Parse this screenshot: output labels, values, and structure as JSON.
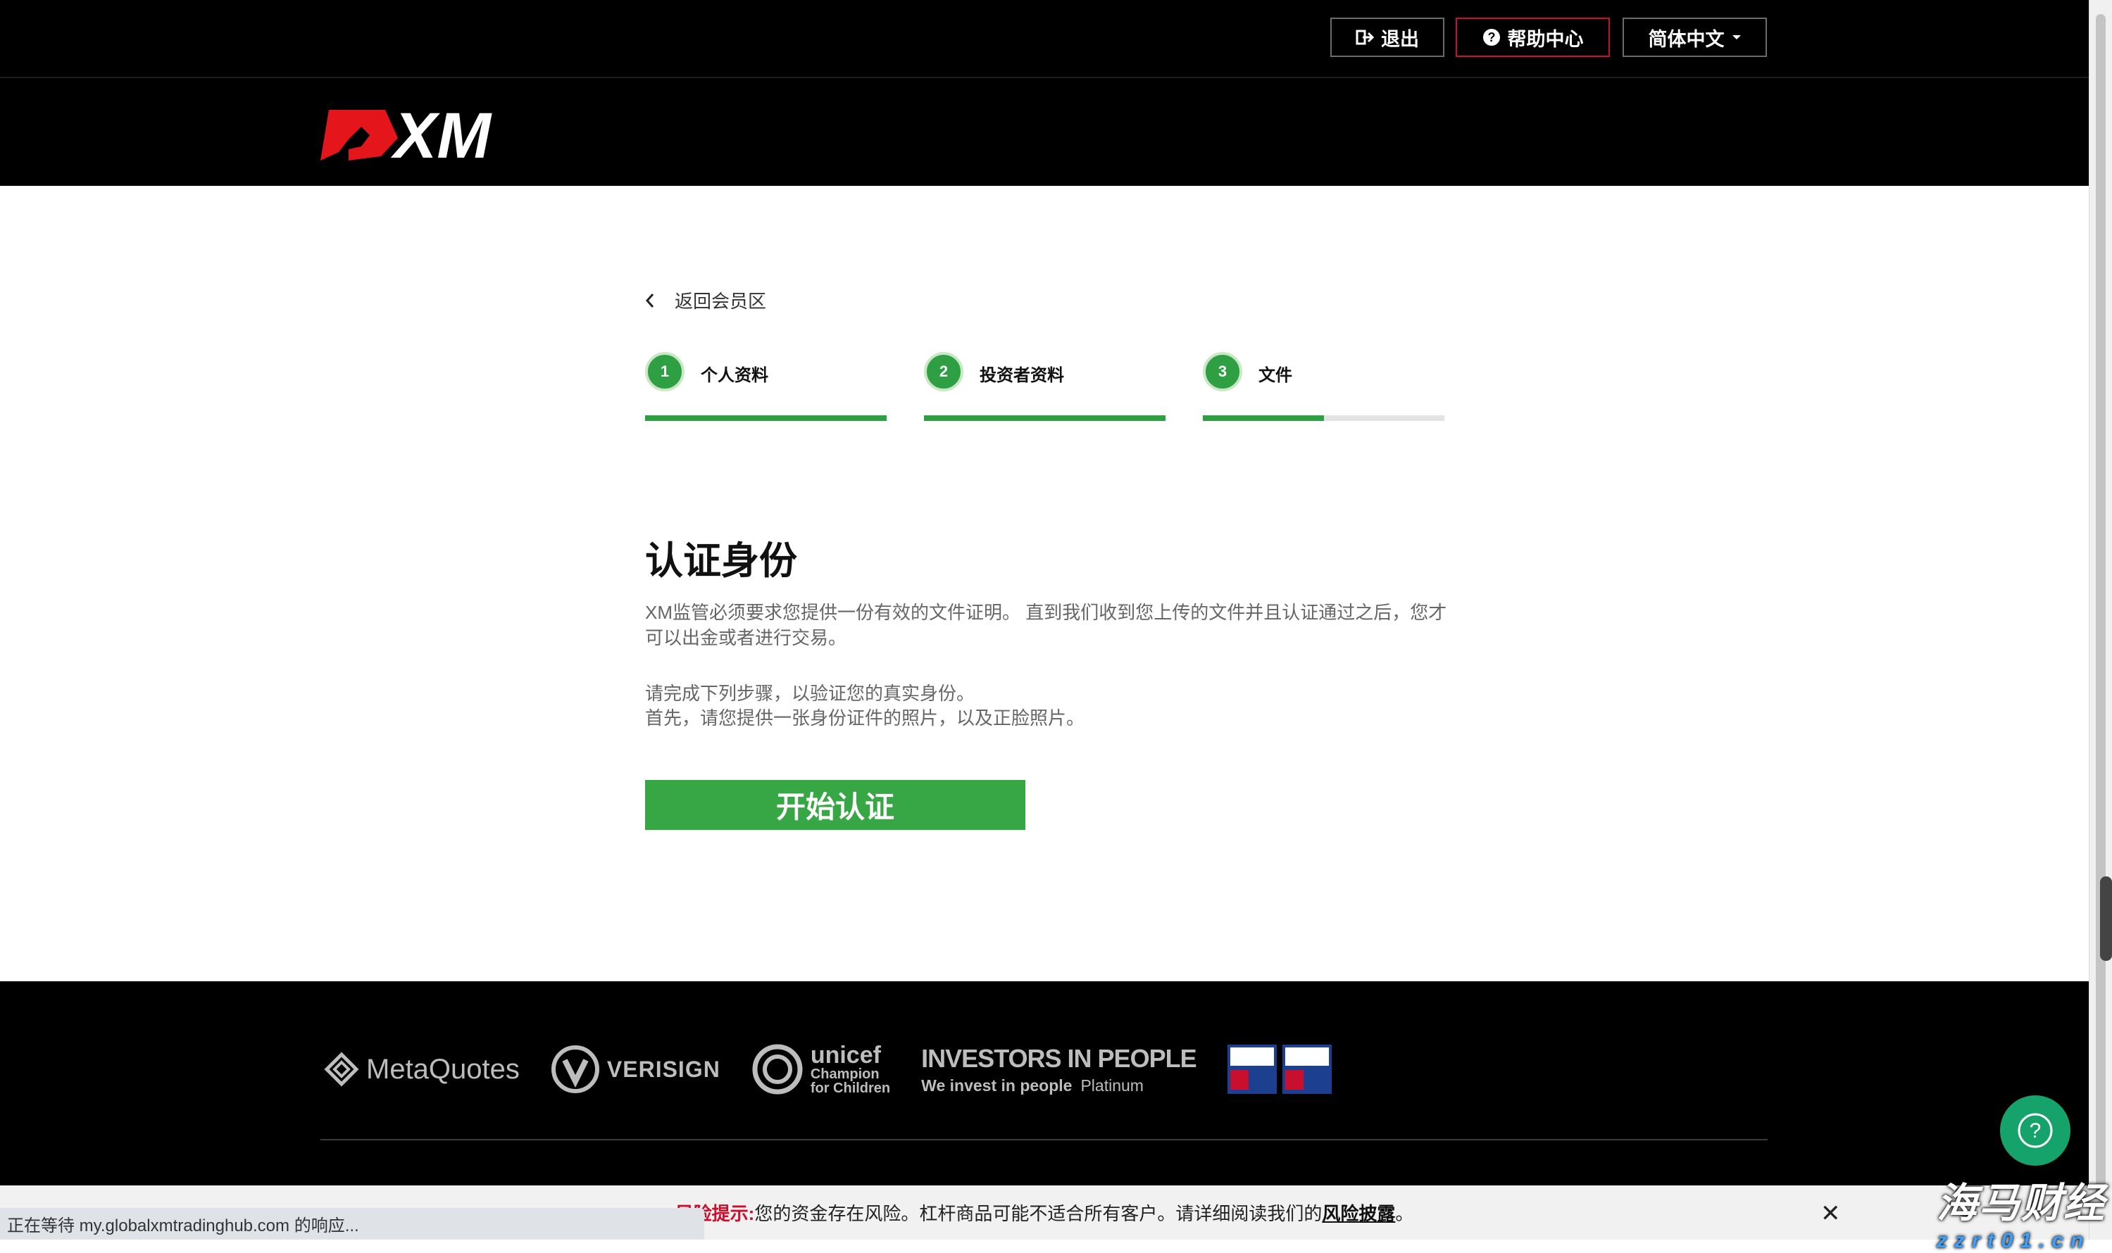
{
  "topbar": {
    "logout_label": "退出",
    "help_label": "帮助中心",
    "language_label": "简体中文"
  },
  "brand": {
    "logo_text": "XM"
  },
  "nav": {
    "back_label": "返回会员区"
  },
  "steps": [
    {
      "number": "1",
      "label": "个人资料",
      "progress": 1.0
    },
    {
      "number": "2",
      "label": "投资者资料",
      "progress": 1.0
    },
    {
      "number": "3",
      "label": "文件",
      "progress": 0.5
    }
  ],
  "main": {
    "title": "认证身份",
    "paragraph1": "XM监管必须要求您提供一份有效的文件证明。 直到我们收到您上传的文件并且认证通过之后，您才可以出金或者进行交易。",
    "paragraph2_line1": "请完成下列步骤，以验证您的真实身份。",
    "paragraph2_line2": "首先，请您提供一张身份证件的照片，以及正脸照片。",
    "start_button": "开始认证"
  },
  "footer": {
    "partners": {
      "metaquotes": "MetaQuotes",
      "verisign": "VERISIGN",
      "unicef_top": "unicef",
      "unicef_mid": "Champion",
      "unicef_bottom": "for Children",
      "iip_top": "INVESTORS IN PEOPLE",
      "iip_bottom": "We invest in people",
      "iip_level": "Platinum"
    }
  },
  "risk": {
    "label": "风险提示:",
    "text": " 您的资金存在风险。杠杆商品可能不适合所有客户。请详细阅读我们的",
    "link": "风险披露",
    "end": "。"
  },
  "status": {
    "text": "正在等待 my.globalxmtradinghub.com 的响应..."
  },
  "watermark": {
    "cn": "海马财经",
    "en": "zzrt01.cn"
  },
  "colors": {
    "accent_green": "#2ea043",
    "brand_red": "#c8102e",
    "fab_green": "#16a26b"
  }
}
